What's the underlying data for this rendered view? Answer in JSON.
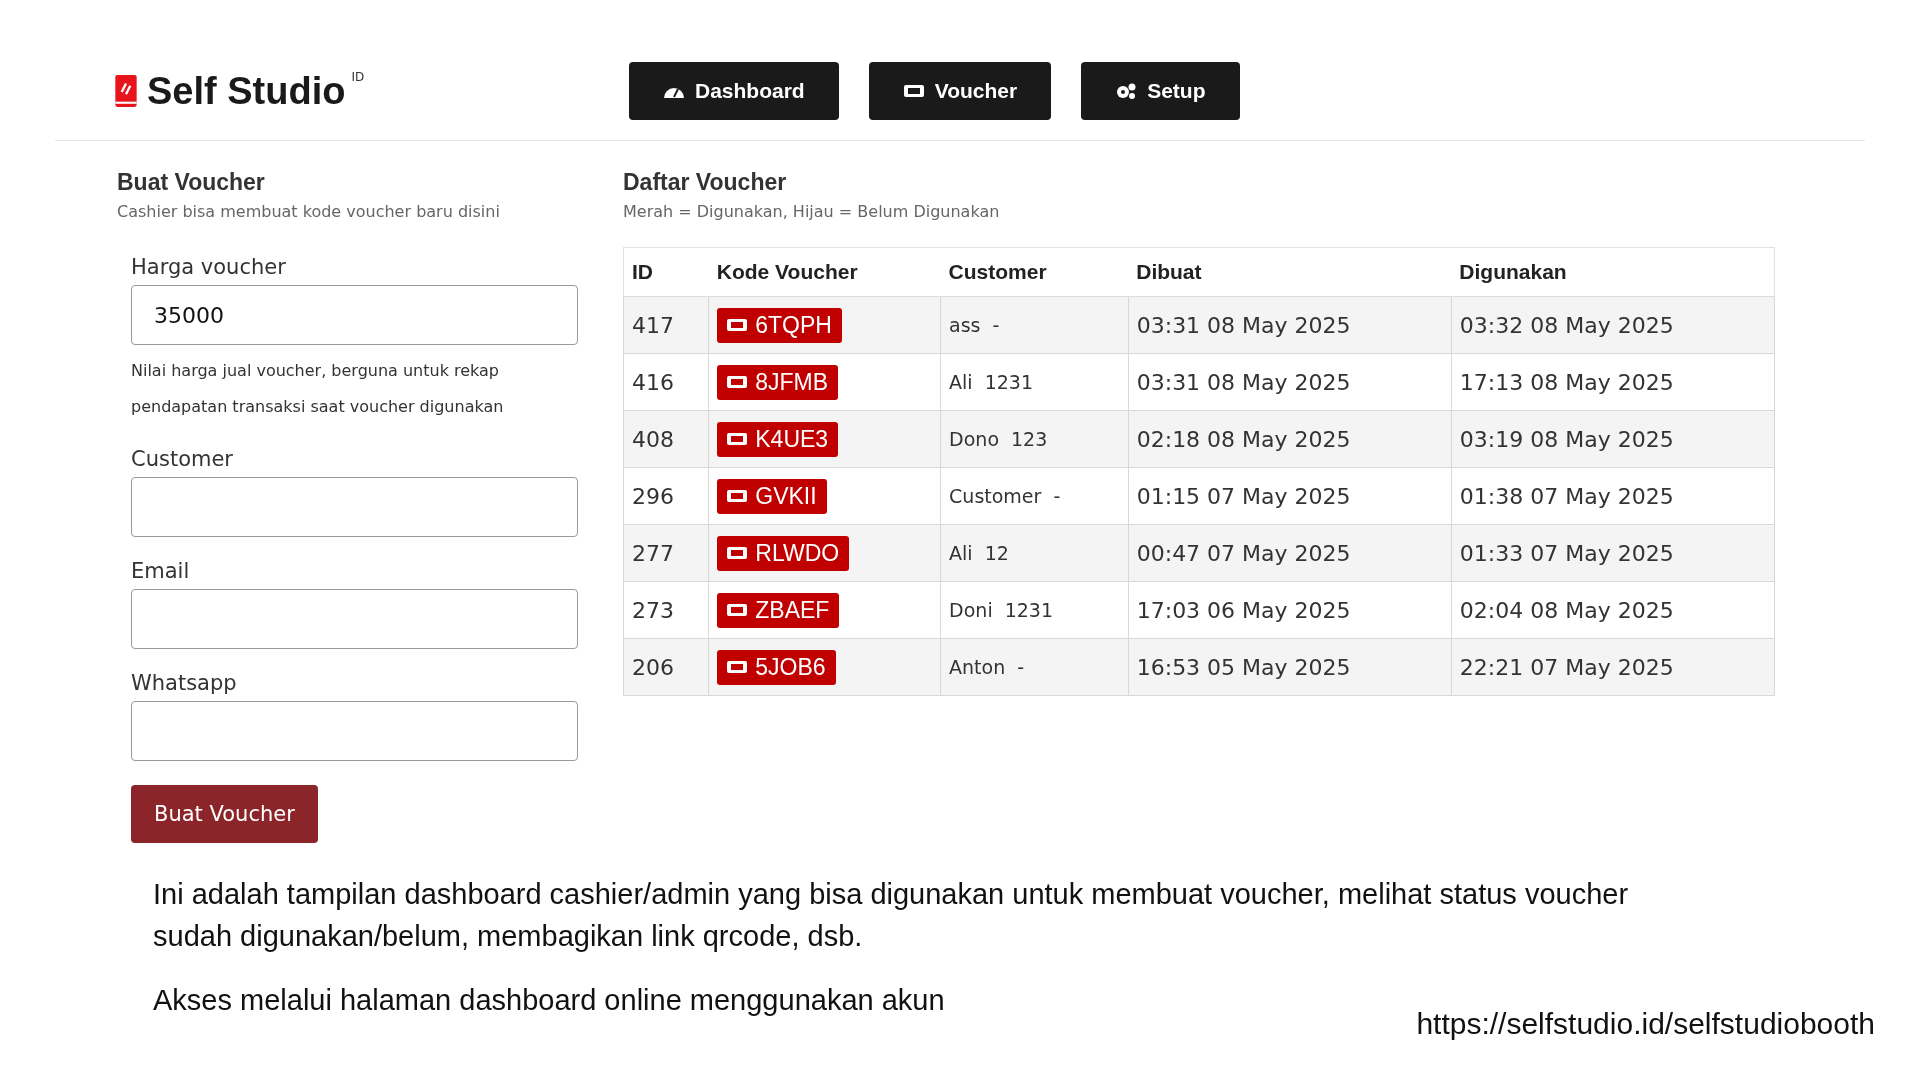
{
  "header": {
    "logo": {
      "text": "Self Studio",
      "superscript": "ID"
    },
    "nav": [
      {
        "label": "Dashboard",
        "kind": "gauge"
      },
      {
        "label": "Voucher",
        "kind": "ticket"
      },
      {
        "label": "Setup",
        "kind": "gears"
      }
    ]
  },
  "form": {
    "title": "Buat Voucher",
    "subtitle": "Cashier bisa membuat kode voucher baru disini",
    "fields": [
      {
        "label": "Harga voucher",
        "value": "35000",
        "help": "Nilai harga jual voucher, berguna untuk rekap pendapatan transaksi saat voucher digunakan"
      },
      {
        "label": "Customer"
      },
      {
        "label": "Email"
      },
      {
        "label": "Whatsapp"
      }
    ],
    "submit": "Buat Voucher"
  },
  "list": {
    "title": "Daftar Voucher",
    "subtitle": "Merah = Digunakan, Hijau = Belum Digunakan",
    "table": {
      "columns": [
        "ID",
        "Kode Voucher",
        "Customer",
        "Dibuat",
        "Digunakan"
      ],
      "rows": [
        {
          "id": "417",
          "code": "6TQPH",
          "used": true,
          "customer": "ass",
          "contact": "-",
          "created": "03:31 08 May 2025",
          "used_at": "03:32 08 May 2025"
        },
        {
          "id": "416",
          "code": "8JFMB",
          "used": true,
          "customer": "Ali",
          "contact": "1231",
          "created": "03:31 08 May 2025",
          "used_at": "17:13 08 May 2025"
        },
        {
          "id": "408",
          "code": "K4UE3",
          "used": true,
          "customer": "Dono",
          "contact": "123",
          "created": "02:18 08 May 2025",
          "used_at": "03:19 08 May 2025"
        },
        {
          "id": "296",
          "code": "GVKII",
          "used": true,
          "customer": "Customer",
          "contact": "-",
          "created": "01:15 07 May 2025",
          "used_at": "01:38 07 May 2025"
        },
        {
          "id": "277",
          "code": "RLWDO",
          "used": true,
          "customer": "Ali",
          "contact": "12",
          "created": "00:47 07 May 2025",
          "used_at": "01:33 07 May 2025"
        },
        {
          "id": "273",
          "code": "ZBAEF",
          "used": true,
          "customer": "Doni",
          "contact": "1231",
          "created": "17:03 06 May 2025",
          "used_at": "02:04 08 May 2025"
        },
        {
          "id": "206",
          "code": "5JOB6",
          "used": true,
          "customer": "Anton",
          "contact": "-",
          "created": "16:53 05 May 2025",
          "used_at": "22:21 07 May 2025"
        }
      ]
    }
  },
  "caption": {
    "paragraphs": [
      "Ini adalah tampilan dashboard cashier/admin yang bisa digunakan untuk membuat voucher, melihat status voucher sudah digunakan/belum, membagikan link qrcode, dsb.",
      "Akses melalui halaman dashboard online menggunakan akun"
    ],
    "url": "https://selfstudio.id/selfstudiobooth"
  }
}
